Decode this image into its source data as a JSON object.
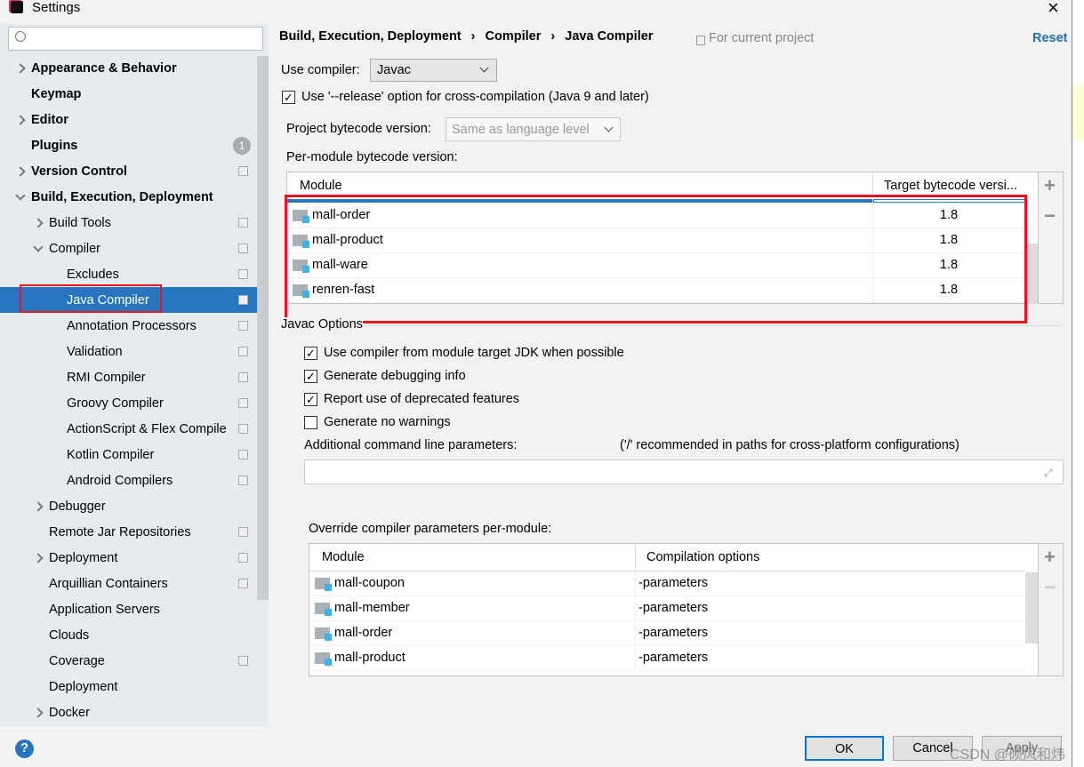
{
  "window": {
    "title": "Settings",
    "close": "×"
  },
  "search": {
    "placeholder": ""
  },
  "sidebar": {
    "items": [
      {
        "label": "Appearance & Behavior",
        "level": 0,
        "bold": true,
        "arrow": "right"
      },
      {
        "label": "Keymap",
        "level": 0,
        "bold": true
      },
      {
        "label": "Editor",
        "level": 0,
        "bold": true,
        "arrow": "right"
      },
      {
        "label": "Plugins",
        "level": 0,
        "bold": true,
        "badge": "1"
      },
      {
        "label": "Version Control",
        "level": 0,
        "bold": true,
        "arrow": "right",
        "copy": true
      },
      {
        "label": "Build, Execution, Deployment",
        "level": 0,
        "bold": true,
        "arrow": "down"
      },
      {
        "label": "Build Tools",
        "level": 1,
        "arrow": "right",
        "copy": true
      },
      {
        "label": "Compiler",
        "level": 1,
        "arrow": "down",
        "copy": true
      },
      {
        "label": "Excludes",
        "level": 2,
        "copy": true
      },
      {
        "label": "Java Compiler",
        "level": 2,
        "copy": true,
        "selected": true
      },
      {
        "label": "Annotation Processors",
        "level": 2,
        "copy": true
      },
      {
        "label": "Validation",
        "level": 2,
        "copy": true
      },
      {
        "label": "RMI Compiler",
        "level": 2,
        "copy": true
      },
      {
        "label": "Groovy Compiler",
        "level": 2,
        "copy": true
      },
      {
        "label": "ActionScript & Flex Compile",
        "level": 2,
        "copy": true
      },
      {
        "label": "Kotlin Compiler",
        "level": 2,
        "copy": true
      },
      {
        "label": "Android Compilers",
        "level": 2,
        "copy": true
      },
      {
        "label": "Debugger",
        "level": 1,
        "arrow": "right"
      },
      {
        "label": "Remote Jar Repositories",
        "level": 1,
        "copy": true
      },
      {
        "label": "Deployment",
        "level": 1,
        "arrow": "right",
        "copy": true
      },
      {
        "label": "Arquillian Containers",
        "level": 1,
        "copy": true
      },
      {
        "label": "Application Servers",
        "level": 1
      },
      {
        "label": "Clouds",
        "level": 1
      },
      {
        "label": "Coverage",
        "level": 1,
        "copy": true
      },
      {
        "label": "Deployment",
        "level": 1
      },
      {
        "label": "Docker",
        "level": 1,
        "arrow": "right"
      }
    ]
  },
  "breadcrumb": [
    "Build, Execution, Deployment",
    "Compiler",
    "Java Compiler"
  ],
  "breadcrumb_sep": "›",
  "for_project": "For current project",
  "reset": "Reset",
  "use_compiler": {
    "label": "Use compiler:",
    "value": "Javac"
  },
  "release_option": {
    "label": "Use '--release' option for cross-compilation (Java 9 and later)",
    "checked": true
  },
  "project_bytecode": {
    "label": "Project bytecode version:",
    "placeholder": "Same as language level"
  },
  "per_module": {
    "label": "Per-module bytecode version:",
    "columns": [
      "Module",
      "Target bytecode versi..."
    ],
    "rows": [
      {
        "module": "mall-order",
        "version": "1.8"
      },
      {
        "module": "mall-product",
        "version": "1.8"
      },
      {
        "module": "mall-ware",
        "version": "1.8"
      },
      {
        "module": "renren-fast",
        "version": "1.8"
      }
    ]
  },
  "javac_options": {
    "title": "Javac Options",
    "checks": [
      {
        "label": "Use compiler from module target JDK when possible",
        "checked": true
      },
      {
        "label": "Generate debugging info",
        "checked": true
      },
      {
        "label": "Report use of deprecated features",
        "checked": true
      },
      {
        "label": "Generate no warnings",
        "checked": false
      }
    ],
    "additional_label": "Additional command line parameters:",
    "additional_hint": "('/' recommended in paths for cross-platform configurations)",
    "additional_value": ""
  },
  "override": {
    "label": "Override compiler parameters per-module:",
    "columns": [
      "Module",
      "Compilation options"
    ],
    "rows": [
      {
        "module": "mall-coupon",
        "options": "-parameters"
      },
      {
        "module": "mall-member",
        "options": "-parameters"
      },
      {
        "module": "mall-order",
        "options": "-parameters"
      },
      {
        "module": "mall-product",
        "options": "-parameters"
      }
    ]
  },
  "buttons": {
    "ok": "OK",
    "cancel": "Cancel",
    "apply": "Apply",
    "help": "?",
    "add": "+",
    "remove": "−"
  },
  "watermark": "CSDN @硕风和炜",
  "colors": {
    "accent": "#2675bf",
    "link": "#2470b3",
    "highlight": "#e8141f"
  }
}
